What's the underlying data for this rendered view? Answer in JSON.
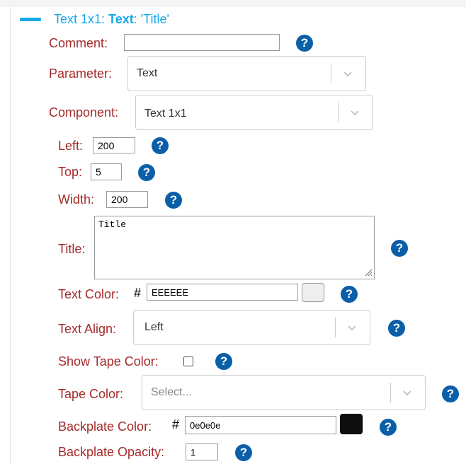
{
  "header": {
    "prefix": "Text 1x1: ",
    "type": "Text",
    "suffix": ": 'Title'"
  },
  "comment": {
    "label": "Comment:",
    "value": ""
  },
  "parameter": {
    "label": "Parameter:",
    "value": "Text"
  },
  "component": {
    "label": "Component:",
    "value": "Text 1x1"
  },
  "left": {
    "label": "Left:",
    "value": "200"
  },
  "top": {
    "label": "Top:",
    "value": "5"
  },
  "width": {
    "label": "Width:",
    "value": "200"
  },
  "title": {
    "label": "Title:",
    "value": "Title"
  },
  "text_color": {
    "label": "Text Color:",
    "hash": "#",
    "value": "EEEEEE",
    "swatch": "#eeeeee"
  },
  "text_align": {
    "label": "Text Align:",
    "value": "Left"
  },
  "show_tape_color": {
    "label": "Show Tape Color:",
    "checked": false
  },
  "tape_color": {
    "label": "Tape Color:",
    "placeholder": "Select..."
  },
  "backplate_color": {
    "label": "Backplate Color:",
    "hash": "#",
    "value": "0e0e0e",
    "swatch": "#0e0e0e"
  },
  "backplate_opacity": {
    "label": "Backplate Opacity:",
    "value": "1"
  },
  "help_glyph": "?",
  "colors": {
    "accent": "#16a8e8",
    "label": "#a52a2a",
    "help": "#0a5fa8"
  }
}
